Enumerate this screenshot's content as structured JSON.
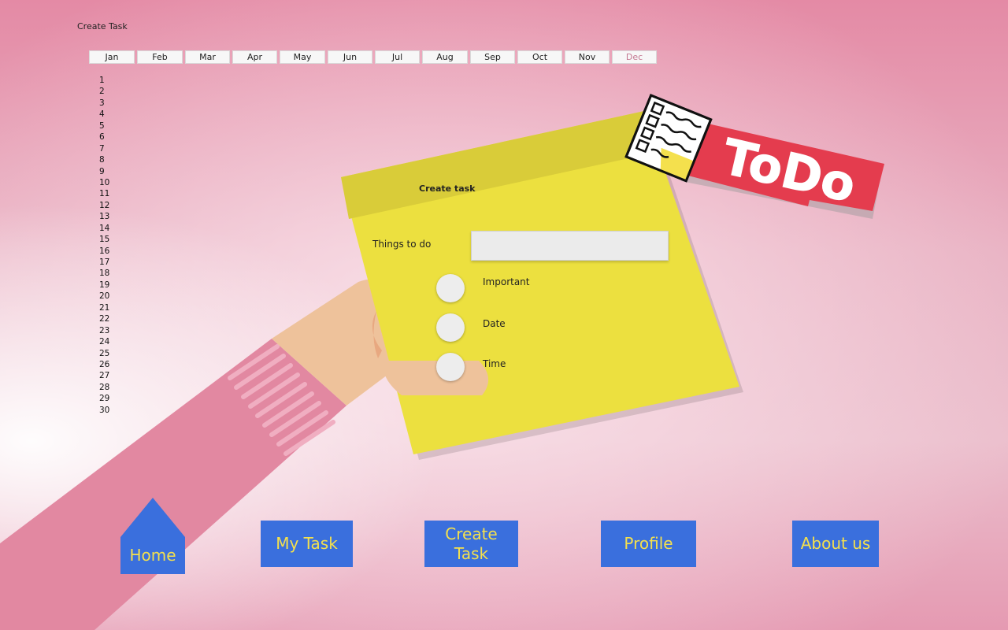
{
  "window": {
    "title": "Create Task"
  },
  "months": [
    "Jan",
    "Feb",
    "Mar",
    "Apr",
    "May",
    "Jun",
    "Jul",
    "Aug",
    "Sep",
    "Oct",
    "Nov",
    "Dec"
  ],
  "selected_month": "Dec",
  "days": [
    "1",
    "2",
    "3",
    "4",
    "5",
    "6",
    "7",
    "8",
    "9",
    "10",
    "11",
    "12",
    "13",
    "14",
    "15",
    "16",
    "17",
    "18",
    "19",
    "20",
    "21",
    "22",
    "23",
    "24",
    "25",
    "26",
    "27",
    "28",
    "29",
    "30"
  ],
  "logo": {
    "text": "ToDo"
  },
  "task_form": {
    "title": "Create task",
    "things_label": "Things to do",
    "things_value": "",
    "options": [
      {
        "label": "Important"
      },
      {
        "label": "Date"
      },
      {
        "label": "Time"
      }
    ]
  },
  "nav": {
    "home": "Home",
    "my_task": "My Task",
    "create_task": "Create Task",
    "profile": "Profile",
    "about": "About us"
  },
  "colors": {
    "background": "#e9b2c3",
    "sticky": "#ece03f",
    "nav_button": "#3a6fdd",
    "nav_text": "#f4e04d",
    "logo_banner": "#e43c4e",
    "sleeve": "#e288a1"
  }
}
